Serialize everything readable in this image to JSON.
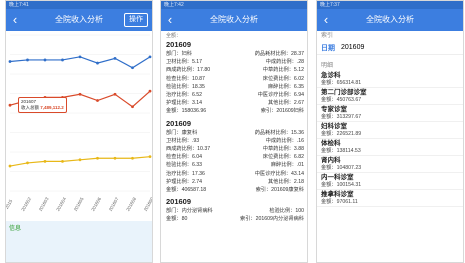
{
  "status": {
    "time1": "晚上7:41",
    "time2": "晚上7:42",
    "time3": "晚上7:37"
  },
  "app": {
    "title": "全院收入分析",
    "op_label": "操作"
  },
  "chart": {
    "x_labels": [
      "2015",
      "201602",
      "201603",
      "201604",
      "201605",
      "201606",
      "201607",
      "201608",
      "201609"
    ],
    "tooltip_title": "201607",
    "tooltip_series": "收入总额",
    "tooltip_value": "7,489,112.2",
    "info_label": "信息"
  },
  "chart_data": {
    "type": "line",
    "x": [
      "2015",
      "201602",
      "201603",
      "201604",
      "201605",
      "201606",
      "201607",
      "201608",
      "201609"
    ],
    "series": [
      {
        "name": "series-blue",
        "color": "#2f6ec9",
        "values": [
          0.83,
          0.84,
          0.84,
          0.84,
          0.86,
          0.82,
          0.85,
          0.79,
          0.86
        ]
      },
      {
        "name": "收入总额",
        "color": "#d94a2a",
        "values": [
          0.55,
          0.58,
          0.6,
          0.6,
          0.62,
          0.58,
          0.62,
          0.54,
          0.64
        ]
      },
      {
        "name": "series-yellow",
        "color": "#e8b818",
        "values": [
          0.16,
          0.18,
          0.19,
          0.19,
          0.2,
          0.21,
          0.21,
          0.21,
          0.22
        ]
      }
    ],
    "grid": true
  },
  "list": {
    "top_partial": "全额：",
    "records": [
      {
        "header": "201609",
        "rows": [
          [
            "部门：妇科",
            "药品耗材比例：28.37"
          ],
          [
            "卫材比例：5.17",
            "中成药比例：.28"
          ],
          [
            "西成药比例：17.80",
            "中草药比例：5.12"
          ],
          [
            "检查比例：10.87",
            "床位费比例：6.02"
          ],
          [
            "检验比例：18.35",
            "麻醉比例：6.35"
          ],
          [
            "治疗比例：6.52",
            "中医诊疗比例：6.94"
          ],
          [
            "护理比例：3.14",
            "其他比例：2.67"
          ],
          [
            "金额：158036.96",
            "索引：201609妇科"
          ]
        ]
      },
      {
        "header": "201609",
        "rows": [
          [
            "部门：康复科",
            "药品耗材比例：15.36"
          ],
          [
            "卫材比例：.93",
            "中成药比例：.16"
          ],
          [
            "西成药比例：10.37",
            "中草药比例：3.88"
          ],
          [
            "检查比例：6.04",
            "床位费比例：6.82"
          ],
          [
            "检验比例：6.33",
            "麻醉比例：.01"
          ],
          [
            "治疗比例：17.36",
            "中医诊疗比例：43.14"
          ],
          [
            "护理比例：2.74",
            "其他比例：2.18"
          ],
          [
            "金额：406587.18",
            "索引：201609康复科"
          ]
        ]
      },
      {
        "header": "201609",
        "rows": [
          [
            "部门：内分泌肾病科",
            "检验比例：100"
          ],
          [
            "金额：80",
            "索引：201609内分泌肾病科"
          ]
        ]
      }
    ]
  },
  "detail": {
    "index_label": "索引",
    "date_label": "日期",
    "date_value": "201609",
    "section_label": "明细",
    "items": [
      {
        "name": "急诊科",
        "amount": "金额：656314.81"
      },
      {
        "name": "第二门诊部诊室",
        "amount": "金额：450763.67"
      },
      {
        "name": "专家诊室",
        "amount": "金额：313297.67"
      },
      {
        "name": "妇科诊室",
        "amount": "金额：226521.89"
      },
      {
        "name": "体检科",
        "amount": "金额：138114.53"
      },
      {
        "name": "肾内科",
        "amount": "金额：104807.23"
      },
      {
        "name": "内一科诊室",
        "amount": "金额：100154.31"
      },
      {
        "name": "推拿科诊室",
        "amount": "金额：97061.11"
      }
    ]
  }
}
